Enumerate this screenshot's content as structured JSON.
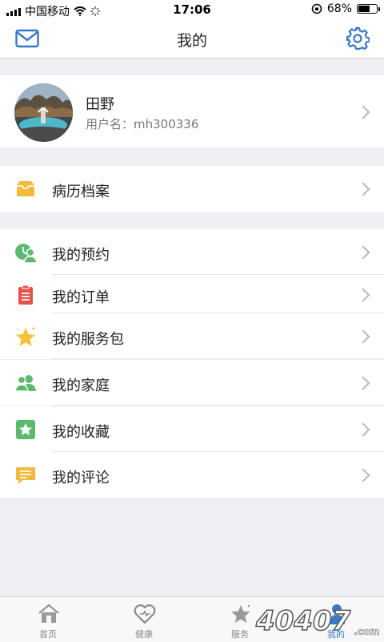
{
  "status_bar": {
    "carrier": "中国移动",
    "time": "17:06",
    "battery": "68%",
    "battery_level": 0.68
  },
  "header": {
    "title": "我的",
    "left_icon": "mail-icon",
    "right_icon": "gear-icon"
  },
  "profile": {
    "name": "田野",
    "username_line": "用户名：mh300336"
  },
  "records": {
    "label": "病历档案",
    "icon": "folder-icon",
    "color": "#f2bb3c"
  },
  "menu": [
    {
      "label": "我的预约",
      "icon": "appointment-icon",
      "color": "#5cba6e"
    },
    {
      "label": "我的订单",
      "icon": "clipboard-icon",
      "color": "#e5534b"
    },
    {
      "label": "我的服务包",
      "icon": "star-icon",
      "color": "#f5c238"
    },
    {
      "label": "我的家庭",
      "icon": "family-icon",
      "color": "#5cba6e"
    },
    {
      "label": "我的收藏",
      "icon": "favorite-icon",
      "color": "#5cba6e"
    },
    {
      "label": "我的评论",
      "icon": "comment-icon",
      "color": "#f2bb3c"
    }
  ],
  "tabs": [
    {
      "label": "首页",
      "icon": "home-icon"
    },
    {
      "label": "健康",
      "icon": "heart-icon"
    },
    {
      "label": "服务",
      "icon": "star-icon"
    },
    {
      "label": "我的",
      "icon": "person-icon",
      "active": true
    }
  ],
  "colors": {
    "accent": "#3b78c7",
    "chevron": "#b8b8bc",
    "background": "#efeff4"
  },
  "watermark_text": "40407.com"
}
